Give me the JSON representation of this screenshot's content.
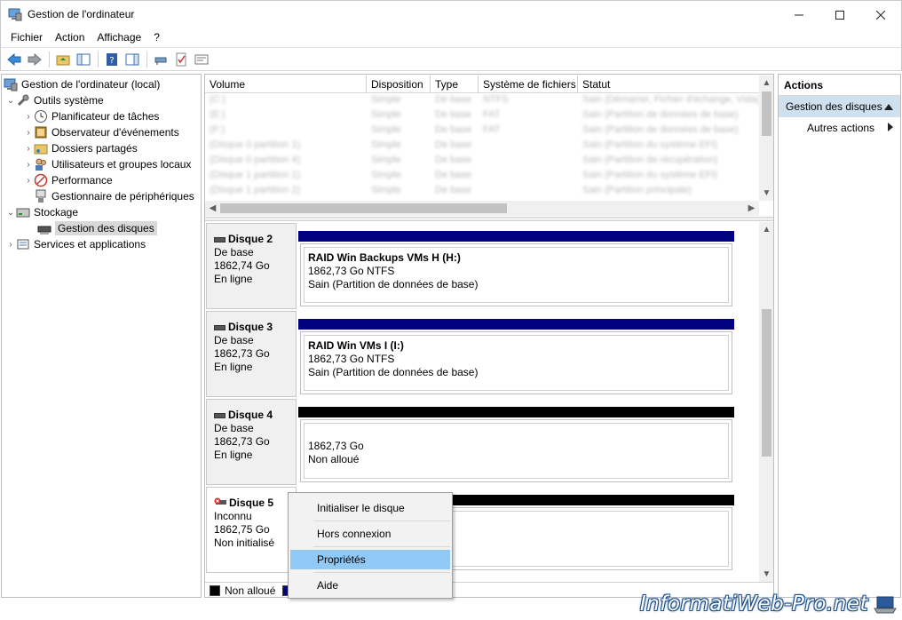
{
  "window": {
    "title": "Gestion de l'ordinateur"
  },
  "menu": [
    "Fichier",
    "Action",
    "Affichage",
    "?"
  ],
  "tree": {
    "root": "Gestion de l'ordinateur (local)",
    "system_tools": "Outils système",
    "task_scheduler": "Planificateur de tâches",
    "event_viewer": "Observateur d'événements",
    "shared_folders": "Dossiers partagés",
    "local_users": "Utilisateurs et groupes locaux",
    "performance": "Performance",
    "device_manager": "Gestionnaire de périphériques",
    "storage": "Stockage",
    "disk_management": "Gestion des disques",
    "services": "Services et applications"
  },
  "volume_list": {
    "columns": [
      "Volume",
      "Disposition",
      "Type",
      "Système de fichiers",
      "Statut"
    ],
    "rows": [
      [
        "(C:)",
        "Simple",
        "De base",
        "NTFS",
        "Sain (Démarrer, Fichier d'échange, Vidage…"
      ],
      [
        "(E:)",
        "Simple",
        "De base",
        "FAT",
        "Sain (Partition de données de base)"
      ],
      [
        "(F:)",
        "Simple",
        "De base",
        "FAT",
        "Sain (Partition de données de base)"
      ],
      [
        "(Disque 0 partition 1)",
        "Simple",
        "De base",
        "",
        "Sain (Partition du système EFI)"
      ],
      [
        "(Disque 0 partition 4)",
        "Simple",
        "De base",
        "",
        "Sain (Partition de récupération)"
      ],
      [
        "(Disque 1 partition 1)",
        "Simple",
        "De base",
        "",
        "Sain (Partition du système EFI)"
      ],
      [
        "(Disque 1 partition 2)",
        "Simple",
        "De base",
        "",
        "Sain (Partition principale)"
      ]
    ]
  },
  "disks": [
    {
      "name": "Disque 2",
      "type": "De base",
      "size": "1862,74 Go",
      "status": "En ligne",
      "part_title": "RAID Win Backups VMs H  (H:)",
      "part_size": "1862,73 Go NTFS",
      "part_status": "Sain (Partition de données de base)",
      "bar_color": "#000080"
    },
    {
      "name": "Disque 3",
      "type": "De base",
      "size": "1862,73 Go",
      "status": "En ligne",
      "part_title": "RAID Win VMs I  (I:)",
      "part_size": "1862,73 Go NTFS",
      "part_status": "Sain (Partition de données de base)",
      "bar_color": "#000080"
    },
    {
      "name": "Disque 4",
      "type": "De base",
      "size": "1862,73 Go",
      "status": "En ligne",
      "part_title": "",
      "part_size": "1862,73 Go",
      "part_status": "Non alloué",
      "bar_color": "#000000"
    },
    {
      "name": "Disque 5",
      "type": "Inconnu",
      "size": "1862,75 Go",
      "status": "Non initialisé",
      "part_title": "",
      "part_size": "",
      "part_status": "",
      "bar_color": "#000000"
    }
  ],
  "legend": {
    "unallocated": "Non alloué",
    "unallocated_color": "#000000",
    "primary_color": "#000080"
  },
  "actions": {
    "title": "Actions",
    "section": "Gestion des disques",
    "more": "Autres actions"
  },
  "context_menu": {
    "items": [
      "Initialiser le disque",
      "Hors connexion",
      "Propriétés",
      "Aide"
    ],
    "highlighted": "Propriétés"
  },
  "watermark": "InformatiWeb-Pro.net",
  "colors": {
    "selection": "#90c8f6",
    "action_header": "#cfe0ee"
  }
}
